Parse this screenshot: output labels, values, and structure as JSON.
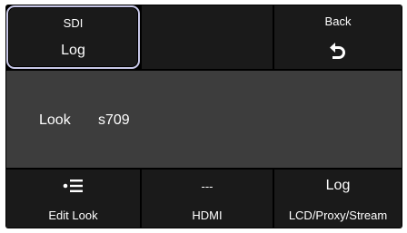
{
  "top_row": {
    "sdi": {
      "title": "SDI",
      "value": "Log"
    },
    "empty": {},
    "back": {
      "title": "Back",
      "icon": "back-arrow-icon"
    }
  },
  "look_panel": {
    "label": "Look",
    "value": "s709"
  },
  "bottom_row": {
    "edit_look": {
      "icon": "list-bullet-icon",
      "label": "Edit Look"
    },
    "hdmi": {
      "value": "---",
      "label": "HDMI"
    },
    "lcd": {
      "value": "Log",
      "label": "LCD/Proxy/Stream"
    }
  },
  "colors": {
    "screen_bg": "#000000",
    "cell_bg": "#1a1a1a",
    "panel_bg": "#3d3d3d",
    "highlight_border": "#c8c8e8",
    "text": "#ffffff"
  }
}
